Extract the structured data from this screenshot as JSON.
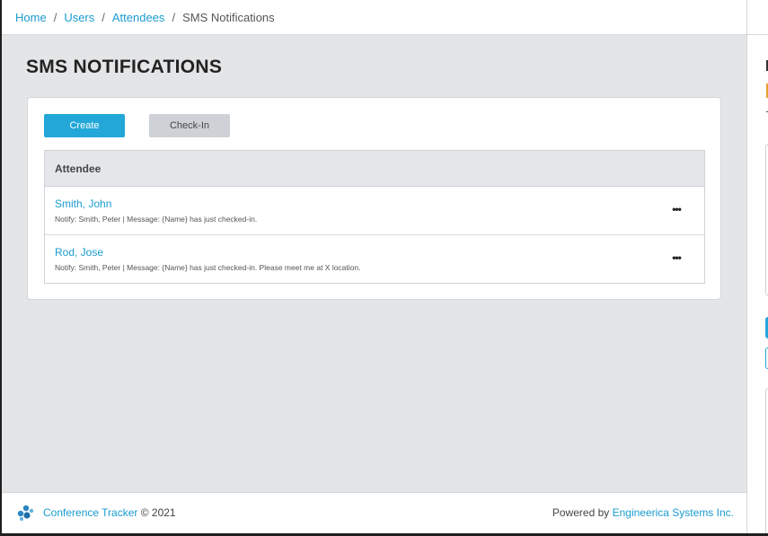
{
  "breadcrumb": {
    "items": [
      "Home",
      "Users",
      "Attendees"
    ],
    "separator": "/",
    "current": "SMS Notifications"
  },
  "page": {
    "title": "SMS NOTIFICATIONS"
  },
  "toolbar": {
    "create_label": "Create",
    "checkin_label": "Check-In"
  },
  "table": {
    "header": "Attendee",
    "rows": [
      {
        "name": "Smith, John",
        "detail": "Notify: Smith, Peter | Message: {Name} has just checked-in.",
        "menu": "•••"
      },
      {
        "name": "Rod, Jose",
        "detail": "Notify: Smith, Peter | Message: {Name} has just checked-in. Please meet me at X location.",
        "menu": "•••"
      }
    ]
  },
  "footer": {
    "app_name": "Conference Tracker",
    "copyright": "© 2021",
    "powered_by": "Powered by",
    "company": "Engineerica Systems Inc."
  },
  "colors": {
    "accent": "#22a7d8",
    "link": "#1a9bd0",
    "background": "#e4e5e7"
  }
}
